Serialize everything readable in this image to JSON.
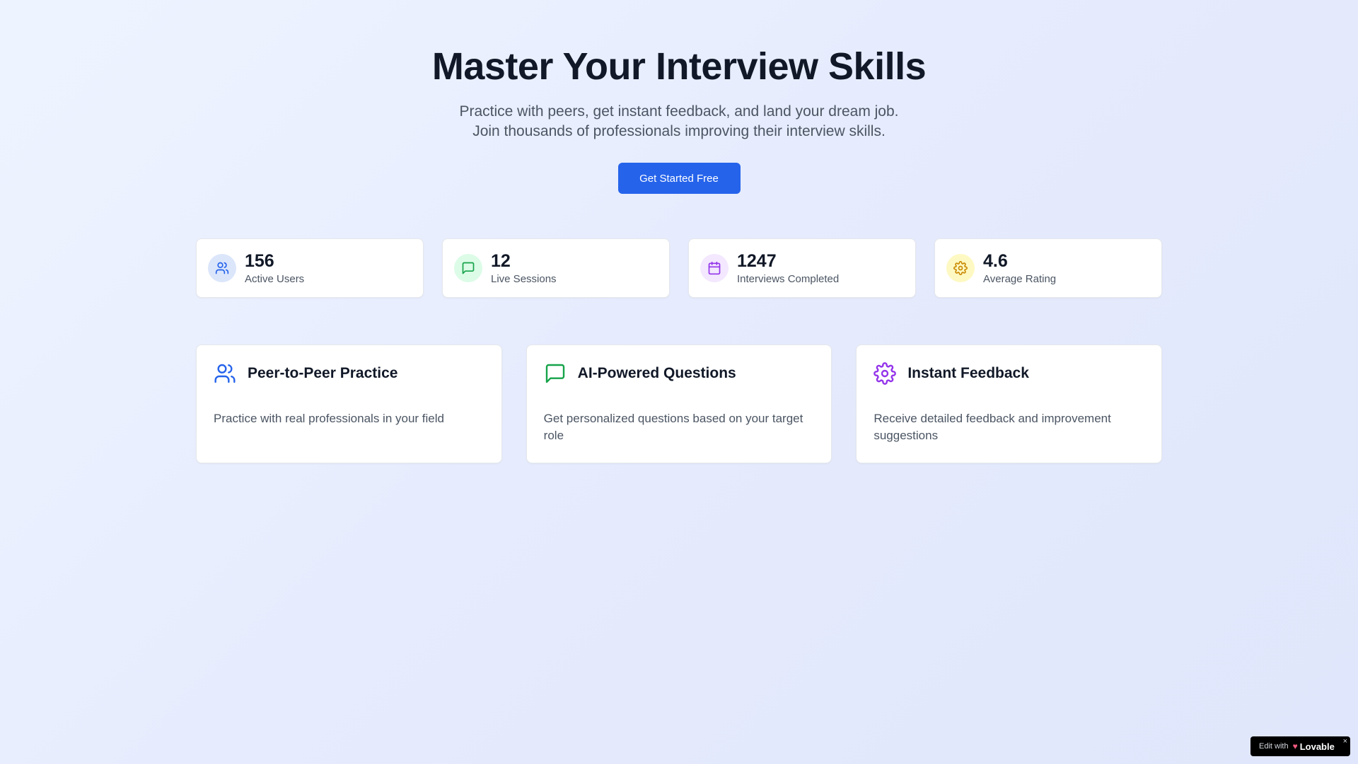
{
  "hero": {
    "title": "Master Your Interview Skills",
    "subtitle_line1": "Practice with peers, get instant feedback, and land your dream job.",
    "subtitle_line2": "Join thousands of professionals improving their interview skills.",
    "cta_label": "Get Started Free"
  },
  "stats": [
    {
      "value": "156",
      "label": "Active Users",
      "icon": "users-icon",
      "icon_color": "#2563eb",
      "icon_bg": "#dbe6fb"
    },
    {
      "value": "12",
      "label": "Live Sessions",
      "icon": "message-icon",
      "icon_color": "#16a34a",
      "icon_bg": "#dcfce7"
    },
    {
      "value": "1247",
      "label": "Interviews Completed",
      "icon": "calendar-icon",
      "icon_color": "#9333ea",
      "icon_bg": "#f3e8ff"
    },
    {
      "value": "4.6",
      "label": "Average Rating",
      "icon": "gear-icon",
      "icon_color": "#ca8a04",
      "icon_bg": "#fef9c3"
    }
  ],
  "features": [
    {
      "title": "Peer-to-Peer Practice",
      "description": "Practice with real professionals in your field",
      "icon": "users-icon",
      "icon_color": "#2563eb"
    },
    {
      "title": "AI-Powered Questions",
      "description": "Get personalized questions based on your target role",
      "icon": "message-icon",
      "icon_color": "#16a34a"
    },
    {
      "title": "Instant Feedback",
      "description": "Receive detailed feedback and improvement suggestions",
      "icon": "gear-icon",
      "icon_color": "#9333ea"
    }
  ],
  "badge": {
    "edit_with": "Edit with",
    "brand": "Lovable",
    "close": "×"
  },
  "colors": {
    "primary": "#2563eb",
    "text_dark": "#111827",
    "text_muted": "#4b5563"
  }
}
